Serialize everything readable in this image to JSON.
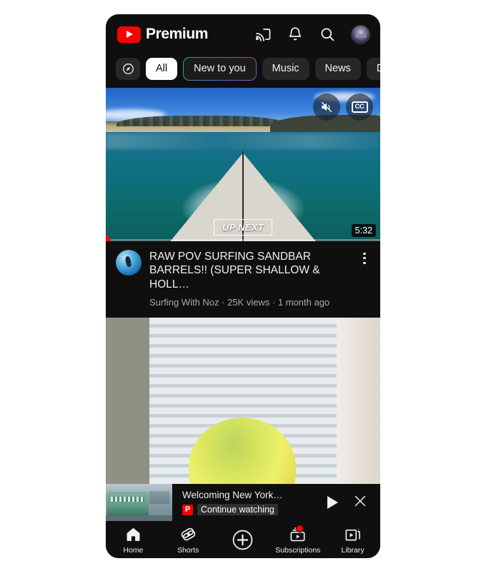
{
  "app": {
    "brand": "Premium",
    "logo_color": "#ff0000"
  },
  "header": {
    "icons": [
      {
        "name": "cast-icon",
        "label": "Cast"
      },
      {
        "name": "bell-icon",
        "label": "Notifications"
      },
      {
        "name": "search-icon",
        "label": "Search"
      },
      {
        "name": "avatar",
        "label": "Account"
      }
    ]
  },
  "chips": {
    "explore_icon": "compass-icon",
    "items": [
      {
        "label": "All",
        "state": "active"
      },
      {
        "label": "New to you",
        "state": "gradient"
      },
      {
        "label": "Music",
        "state": "default"
      },
      {
        "label": "News",
        "state": "default"
      },
      {
        "label": "De",
        "state": "default"
      }
    ]
  },
  "player": {
    "up_next_label": "UP NEXT",
    "duration": "5:32",
    "mute_icon": "mute-icon",
    "cc_icon": "closed-captions-icon",
    "cc_label": "CC",
    "progress_color": "#ff0000"
  },
  "video": {
    "title": "RAW POV SURFING SANDBAR BARRELS!! (SUPER SHALLOW & HOLL…",
    "channel": "Surfing With Noz",
    "views": "25K views",
    "age": "1 month ago",
    "subline": "Surfing With Noz · 25K views · 1 month ago"
  },
  "mini_player": {
    "title": "Welcoming New York…",
    "badge": "P",
    "subtitle": "Continue watching",
    "play_label": "Play",
    "close_label": "Close"
  },
  "bottom_nav": [
    {
      "label": "Home",
      "icon": "home-icon",
      "active": true,
      "badge": false
    },
    {
      "label": "Shorts",
      "icon": "shorts-icon",
      "active": false,
      "badge": false
    },
    {
      "label": "Create",
      "icon": "plus-circle-icon",
      "active": false,
      "badge": false
    },
    {
      "label": "Subscriptions",
      "icon": "subscriptions-icon",
      "active": false,
      "badge": true
    },
    {
      "label": "Library",
      "icon": "library-icon",
      "active": false,
      "badge": false
    }
  ]
}
